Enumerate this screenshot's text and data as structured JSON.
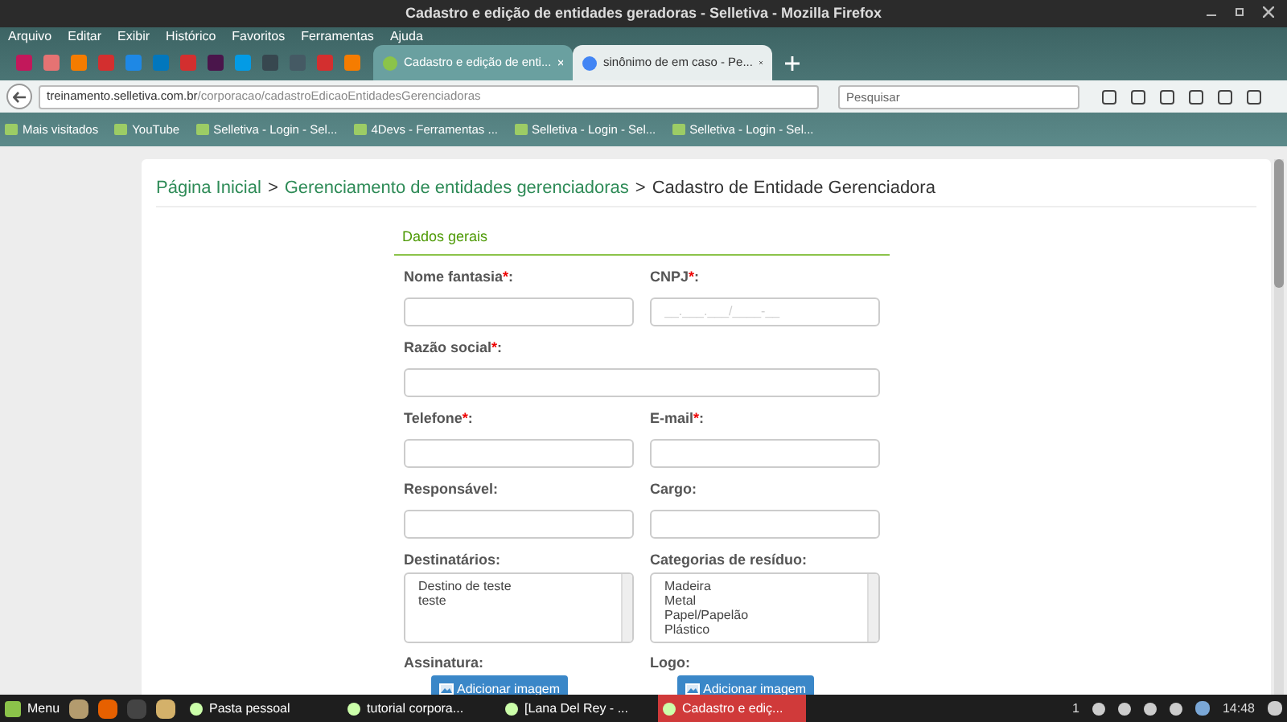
{
  "window": {
    "title": "Cadastro e edição de entidades geradoras - Selletiva - Mozilla Firefox"
  },
  "menu": [
    "Arquivo",
    "Editar",
    "Exibir",
    "Histórico",
    "Favoritos",
    "Ferramentas",
    "Ajuda"
  ],
  "pinned_tabs": [
    {
      "color": "#c2185b"
    },
    {
      "color": "#e57373"
    },
    {
      "color": "#f57c00"
    },
    {
      "color": "#d32f2f"
    },
    {
      "color": "#1e88e5"
    },
    {
      "color": "#0277bd"
    },
    {
      "color": "#d32f2f"
    },
    {
      "color": "#4a154b"
    },
    {
      "color": "#039be5"
    },
    {
      "color": "#37474f"
    },
    {
      "color": "#455a64"
    },
    {
      "color": "#d32f2f"
    },
    {
      "color": "#f57c00"
    }
  ],
  "tabs": [
    {
      "label": "Cadastro e edição de enti...",
      "selected": true
    },
    {
      "label": "sinônimo de em caso - Pe...",
      "selected": false
    }
  ],
  "url_bar": {
    "host": "treinamento.selletiva.com.br",
    "path": "/corporacao/cadastroEdicaoEntidadesGerenciadoras"
  },
  "search": {
    "placeholder": "Pesquisar"
  },
  "bookmarks": [
    "Mais visitados",
    "YouTube",
    "Selletiva - Login - Sel...",
    "4Devs - Ferramentas ...",
    "Selletiva - Login - Sel...",
    "Selletiva - Login - Sel..."
  ],
  "breadcrumb": [
    {
      "label": "Página Inicial",
      "link": true
    },
    {
      "label": "Gerenciamento de entidades gerenciadoras",
      "link": true
    },
    {
      "label": "Cadastro de Entidade Gerenciadora",
      "link": false
    }
  ],
  "breadcrumb_separator": ">",
  "required_mark": "*",
  "label_suffix": ":",
  "section_title": "Dados gerais",
  "rows": [
    [
      {
        "kind": "input",
        "label": "Nome fantasia",
        "required": true
      },
      {
        "kind": "input",
        "label": "CNPJ",
        "required": true,
        "placeholder": "__.___.___/____-__"
      }
    ],
    [
      {
        "kind": "input",
        "label": "Razão social",
        "required": true,
        "wide": true
      }
    ],
    [
      {
        "kind": "input",
        "label": "Telefone",
        "required": true
      },
      {
        "kind": "input",
        "label": "E-mail",
        "required": true
      }
    ],
    [
      {
        "kind": "input",
        "label": "Responsável",
        "required": false
      },
      {
        "kind": "input",
        "label": "Cargo",
        "required": false
      }
    ],
    [
      {
        "kind": "list",
        "label": "Destinatários",
        "required": false,
        "options": [
          "Destino de teste",
          "teste"
        ]
      },
      {
        "kind": "list",
        "label": "Categorias de resíduo",
        "required": false,
        "options": [
          "Madeira",
          "Metal",
          "Papel/Papelão",
          "Plástico"
        ]
      }
    ],
    [
      {
        "kind": "image",
        "label": "Assinatura",
        "required": false,
        "button": "Adicionar imagem"
      },
      {
        "kind": "image",
        "label": "Logo",
        "required": false,
        "button": "Adicionar imagem"
      }
    ]
  ],
  "taskbar": {
    "menu": "Menu",
    "windows": [
      {
        "label": "Pasta pessoal",
        "selected": false
      },
      {
        "label": "tutorial corpora...",
        "selected": false
      },
      {
        "label": "[Lana Del Rey - ...",
        "selected": false
      },
      {
        "label": "Cadastro e ediç...",
        "selected": true
      }
    ],
    "notifications": "1",
    "clock": "14:48"
  }
}
